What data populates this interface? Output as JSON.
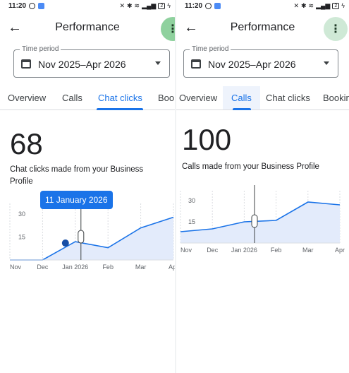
{
  "left": {
    "status": {
      "time": "11:20",
      "battery": "2"
    },
    "title": "Performance",
    "more_icon": "more-vert-icon",
    "time_period": {
      "label": "Time period",
      "value": "Nov 2025–Apr 2026"
    },
    "tabs": [
      {
        "label": "Overview",
        "active": false
      },
      {
        "label": "Calls",
        "active": false
      },
      {
        "label": "Chat clicks",
        "active": true
      },
      {
        "label": "Bool",
        "active": false
      }
    ],
    "metric": {
      "value": "68",
      "description": "Chat clicks made from your Business Profile"
    },
    "tooltip": "11 January 2026",
    "chart_data": {
      "type": "area",
      "x": [
        "Nov",
        "Dec",
        "Jan 2026",
        "Feb",
        "Mar",
        "Apr"
      ],
      "y_ticks": [
        "15",
        "30"
      ],
      "ylim": [
        0,
        37
      ],
      "points": [
        {
          "x": 0,
          "y": 0
        },
        {
          "x": 1,
          "y": 0
        },
        {
          "x": 2,
          "y": 12
        },
        {
          "x": 3,
          "y": 8
        },
        {
          "x": 4,
          "y": 21
        },
        {
          "x": 5,
          "y": 28
        }
      ],
      "highlight_index": 2,
      "line_color": "#1a73e8",
      "fill_color": "#e3ebfb",
      "marker_color": "#174ea6"
    }
  },
  "right": {
    "status": {
      "time": "11:20",
      "battery": "2"
    },
    "title": "Performance",
    "more_icon": "more-vert-icon",
    "time_period": {
      "label": "Time period",
      "value": "Nov 2025–Apr 2026"
    },
    "tabs": [
      {
        "label": "Overview",
        "active": false
      },
      {
        "label": "Calls",
        "active": true
      },
      {
        "label": "Chat clicks",
        "active": false
      },
      {
        "label": "Bookin",
        "active": false
      }
    ],
    "metric": {
      "value": "100",
      "description": "Calls made from your Business Profile"
    },
    "chart_data": {
      "type": "area",
      "x": [
        "Nov",
        "Dec",
        "Jan 2026",
        "Feb",
        "Mar",
        "Apr"
      ],
      "y_ticks": [
        "15",
        "30"
      ],
      "ylim": [
        0,
        37
      ],
      "points": [
        {
          "x": 0,
          "y": 8
        },
        {
          "x": 1,
          "y": 10
        },
        {
          "x": 2,
          "y": 15
        },
        {
          "x": 3,
          "y": 16
        },
        {
          "x": 4,
          "y": 29
        },
        {
          "x": 5,
          "y": 27
        }
      ],
      "handle_index": 2.5,
      "line_color": "#1a73e8",
      "fill_color": "#e3ebfb"
    }
  }
}
